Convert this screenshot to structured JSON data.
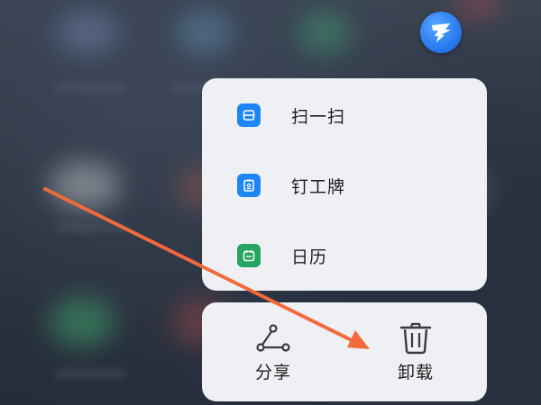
{
  "quick_menu": {
    "items": [
      {
        "label": "扫一扫",
        "icon": "scan-icon"
      },
      {
        "label": "钉工牌",
        "icon": "badge-icon"
      },
      {
        "label": "日历",
        "icon": "calendar-icon"
      }
    ]
  },
  "actions": {
    "share_label": "分享",
    "uninstall_label": "卸载"
  },
  "app": {
    "icon": "dingtalk-app-icon"
  },
  "colors": {
    "menu_bg": "#eef0f3",
    "icon_blue": "#1e86f2",
    "icon_green": "#25a55f",
    "annotation_arrow": "#f26a3c"
  }
}
